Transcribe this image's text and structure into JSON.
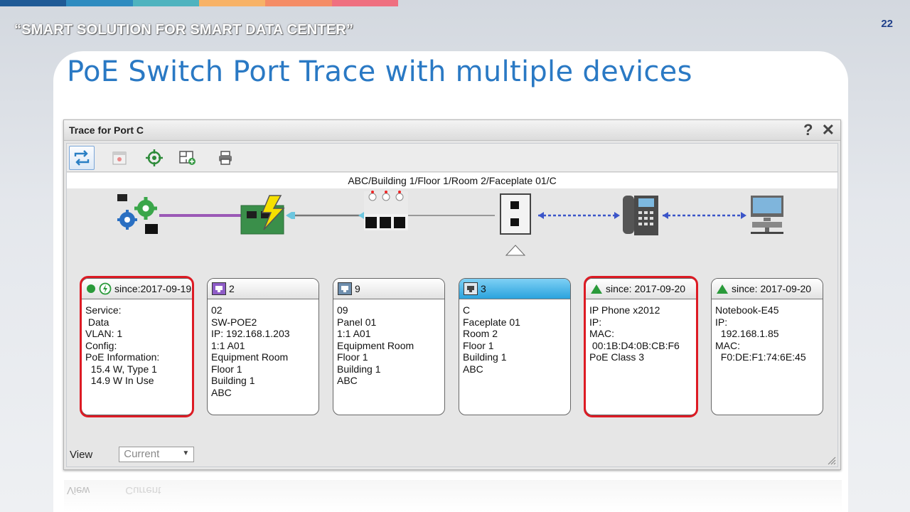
{
  "slide": {
    "topbar_colors": [
      "#1f5a96",
      "#2e8bc0",
      "#4fb3bf",
      "#f7b267",
      "#f48c66",
      "#ef6f80"
    ],
    "tagline": "“SMART SOLUTION FOR SMART DATA CENTER”",
    "page_number": "22",
    "title": "PoE Switch Port Trace with multiple devices"
  },
  "dialog": {
    "title": "Trace for Port C",
    "help_label": "?",
    "close_label": "✕",
    "toolbar": [
      {
        "icon": "refresh-trace-icon",
        "active": true
      },
      {
        "icon": "calendar-icon",
        "active": false
      },
      {
        "icon": "locate-icon",
        "active": false
      },
      {
        "icon": "floorplan-icon",
        "active": false
      },
      {
        "icon": "print-icon",
        "active": false
      }
    ],
    "path": "ABC/Building 1/Floor 1/Room 2/Faceplate 01/C",
    "view_label": "View",
    "view_value": "Current"
  },
  "trace": {
    "devices": [
      {
        "icon": "service-gear-icon"
      },
      {
        "icon": "poe-switch-icon"
      },
      {
        "icon": "patch-panel-icon"
      },
      {
        "icon": "faceplate-icon"
      },
      {
        "icon": "ip-phone-icon"
      },
      {
        "icon": "workstation-icon"
      }
    ],
    "cards": [
      {
        "head": "since:2017-09-19",
        "head_icon": "status-power-icon",
        "lines": [
          "Service:",
          " Data",
          "VLAN: 1",
          "Config:",
          "PoE Information:",
          "  15.4 W, Type 1",
          "  14.9 W In Use"
        ],
        "highlight": true
      },
      {
        "head": "2",
        "head_icon": "switch-port-icon",
        "lines": [
          "02",
          "SW-POE2",
          "IP: 192.168.1.203",
          "1:1 A01",
          "Equipment Room",
          "Floor 1",
          "Building 1",
          "ABC"
        ],
        "highlight": false
      },
      {
        "head": "9",
        "head_icon": "panel-port-icon",
        "lines": [
          "09",
          "Panel 01",
          "1:1 A01",
          "Equipment Room",
          "Floor 1",
          "Building 1",
          "ABC"
        ],
        "highlight": false
      },
      {
        "head": "3",
        "head_icon": "outlet-port-icon",
        "lines": [
          "C",
          "Faceplate 01",
          "Room 2",
          "Floor 1",
          "Building 1",
          "ABC"
        ],
        "highlight": false,
        "selected": true
      },
      {
        "head": "since: 2017-09-20",
        "head_icon": "triangle-status-icon",
        "lines": [
          "IP Phone x2012",
          "IP:",
          "MAC:",
          " 00:1B:D4:0B:CB:F6",
          "PoE Class 3"
        ],
        "highlight": true
      },
      {
        "head": "since: 2017-09-20",
        "head_icon": "triangle-status-icon",
        "lines": [
          "Notebook-E45",
          "IP:",
          "  192.168.1.85",
          "MAC:",
          "  F0:DE:F1:74:6E:45"
        ],
        "highlight": false
      }
    ]
  }
}
